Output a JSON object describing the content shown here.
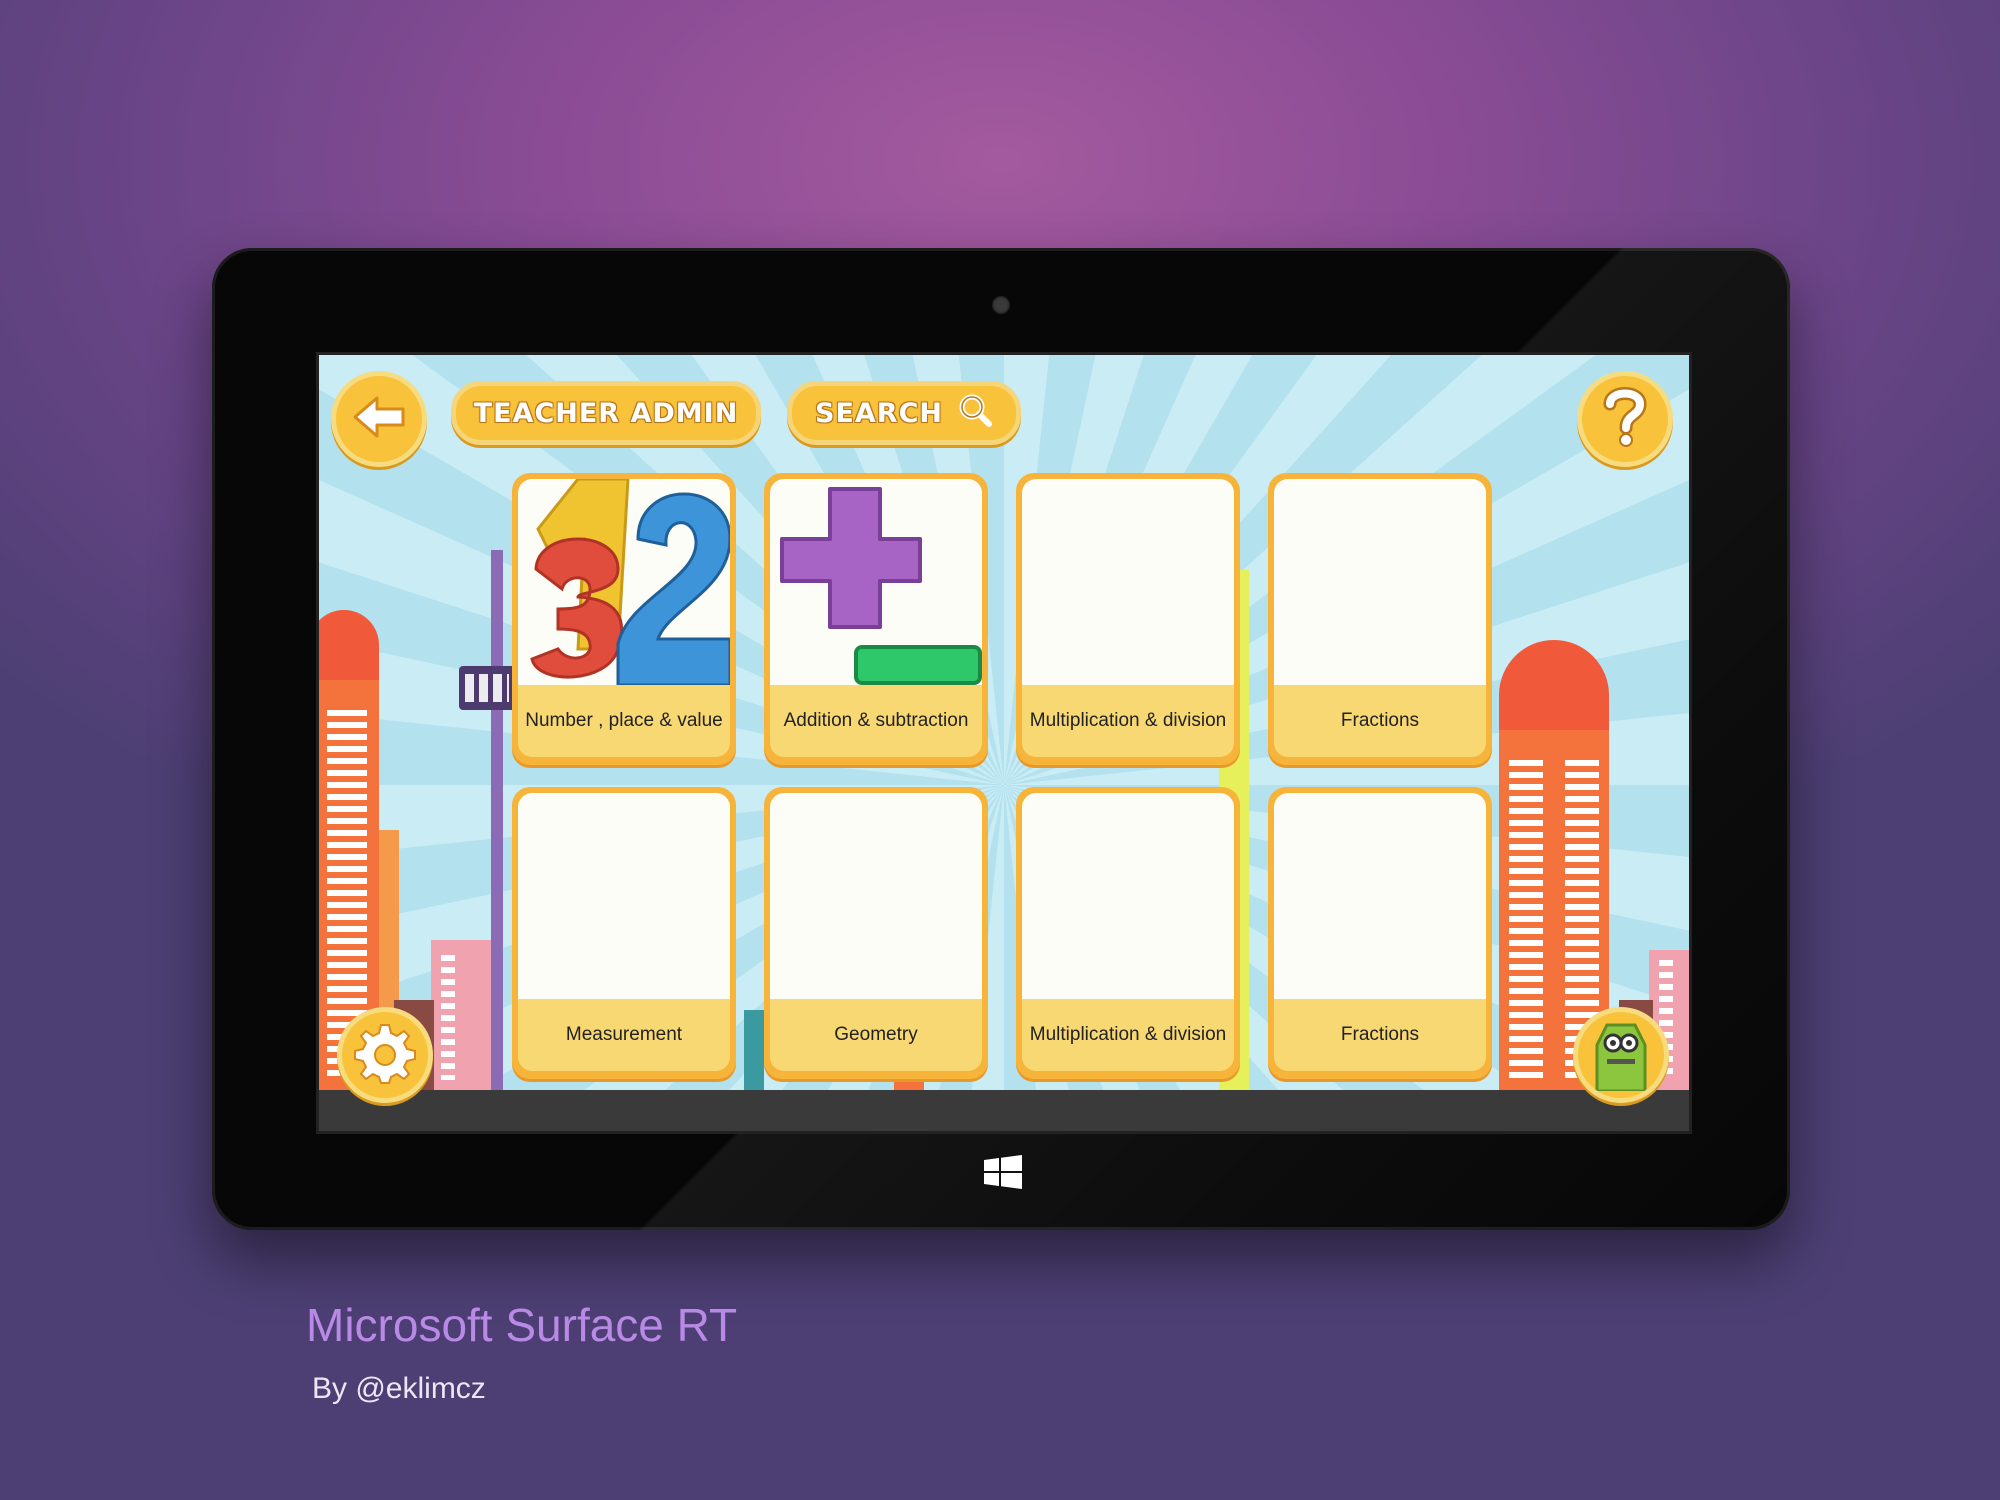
{
  "toolbar": {
    "teacher_admin_label": "TEACHER ADMIN",
    "search_label": "SEARCH"
  },
  "icons": {
    "back": "back-arrow-icon",
    "help": "question-mark-icon",
    "settings": "gear-icon",
    "profile": "robot-avatar-icon",
    "search": "magnifier-icon",
    "windows": "windows-logo-icon"
  },
  "cards": [
    {
      "label": "Number , place & value",
      "art": "numbers-321"
    },
    {
      "label": "Addition & subtraction",
      "art": "plus-minus"
    },
    {
      "label": "Multiplication & division",
      "art": ""
    },
    {
      "label": "Fractions",
      "art": ""
    },
    {
      "label": "Measurement",
      "art": ""
    },
    {
      "label": "Geometry",
      "art": ""
    },
    {
      "label": "Multiplication & division",
      "art": ""
    },
    {
      "label": "Fractions",
      "art": ""
    }
  ],
  "caption": {
    "title": "Microsoft Surface RT",
    "byline": "By @eklimcz"
  },
  "colors": {
    "accent": "#f8c23a",
    "card_border": "#f7b43b",
    "card_label_bg": "#f8d872",
    "caption_title": "#b88ae6"
  }
}
